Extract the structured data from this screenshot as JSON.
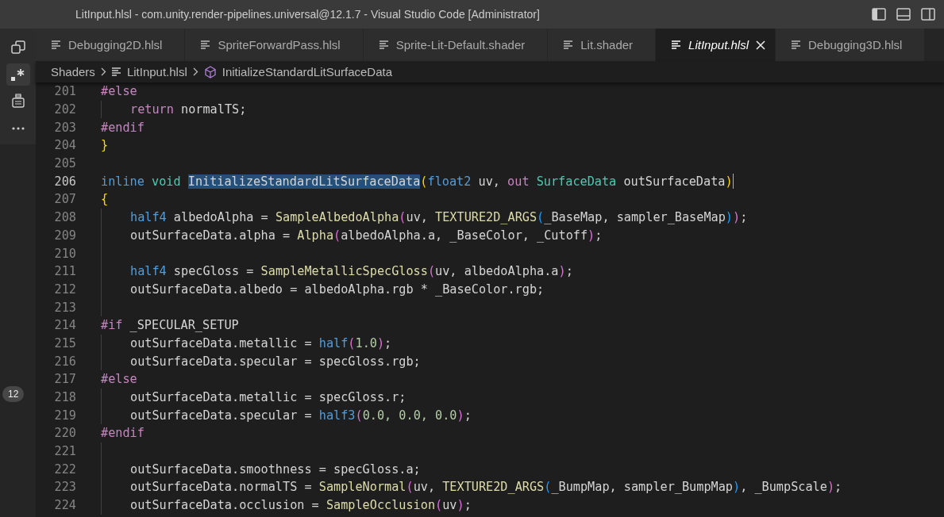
{
  "window": {
    "title": "LitInput.hlsl - com.unity.render-pipelines.universal@12.1.7 - Visual Studio Code [Administrator]"
  },
  "activity_bar": {
    "items": [
      {
        "kind": "copy",
        "selected": false
      },
      {
        "kind": "regex",
        "selected": true
      },
      {
        "kind": "chip",
        "selected": false
      },
      {
        "kind": "more",
        "selected": false
      }
    ],
    "badge": "12"
  },
  "tabs": [
    {
      "label": "Debugging2D.hlsl",
      "selected": false
    },
    {
      "label": "SpriteForwardPass.hlsl",
      "selected": false
    },
    {
      "label": "Sprite-Lit-Default.shader",
      "selected": false
    },
    {
      "label": "Lit.shader",
      "selected": false
    },
    {
      "label": "LitInput.hlsl",
      "selected": true
    },
    {
      "label": "Debugging3D.hlsl",
      "selected": false
    }
  ],
  "breadcrumb": [
    {
      "kind": "folder",
      "label": "Shaders"
    },
    {
      "kind": "file",
      "label": "LitInput.hlsl"
    },
    {
      "kind": "symbol",
      "label": "InitializeStandardLitSurfaceData"
    }
  ],
  "code": [
    {
      "number": "201",
      "current": false,
      "indented": false,
      "tokens": [
        {
          "kind": "pre",
          "text": "#else"
        }
      ]
    },
    {
      "number": "202",
      "current": false,
      "indented": true,
      "tokens": [
        {
          "kind": "pre",
          "text": "return"
        },
        {
          "kind": "text",
          "text": " normalTS;"
        }
      ]
    },
    {
      "number": "203",
      "current": false,
      "indented": false,
      "tokens": [
        {
          "kind": "pre",
          "text": "#endif"
        }
      ]
    },
    {
      "number": "204",
      "current": false,
      "indented": false,
      "tokens": [
        {
          "kind": "b1",
          "text": "}"
        }
      ]
    },
    {
      "number": "205",
      "current": false,
      "indented": false
    },
    {
      "number": "206",
      "current": true,
      "indented": false,
      "tokens": [
        {
          "kind": "type",
          "text": "inline "
        },
        {
          "kind": "cls",
          "text": "void "
        },
        {
          "kind": "selection",
          "text": "InitializeStandardLitSurfaceData"
        },
        {
          "kind": "b1",
          "text": "("
        },
        {
          "kind": "type",
          "text": "float2"
        },
        {
          "kind": "text",
          "text": " uv, "
        },
        {
          "kind": "pre",
          "text": "out "
        },
        {
          "kind": "cls",
          "text": "SurfaceData"
        },
        {
          "kind": "text",
          "text": " outSurfaceData"
        },
        {
          "kind": "b1",
          "text": ")"
        }
      ]
    },
    {
      "number": "207",
      "current": false,
      "indented": false,
      "tokens": [
        {
          "kind": "b1",
          "text": "{"
        }
      ]
    },
    {
      "number": "208",
      "current": false,
      "indented": true,
      "tokens": [
        {
          "kind": "type",
          "text": "half4"
        },
        {
          "kind": "text",
          "text": " albedoAlpha = "
        },
        {
          "kind": "func",
          "text": "SampleAlbedoAlpha"
        },
        {
          "kind": "b2",
          "text": "("
        },
        {
          "kind": "text",
          "text": "uv, "
        },
        {
          "kind": "func",
          "text": "TEXTURE2D_ARGS"
        },
        {
          "kind": "b3",
          "text": "("
        },
        {
          "kind": "text",
          "text": "_BaseMap, sampler_BaseMap"
        },
        {
          "kind": "b3",
          "text": ")"
        },
        {
          "kind": "b2",
          "text": ")"
        },
        {
          "kind": "text",
          "text": ";"
        }
      ]
    },
    {
      "number": "209",
      "current": false,
      "indented": true,
      "tokens": [
        {
          "kind": "text",
          "text": "outSurfaceData.alpha = "
        },
        {
          "kind": "func",
          "text": "Alpha"
        },
        {
          "kind": "b2",
          "text": "("
        },
        {
          "kind": "text",
          "text": "albedoAlpha.a, _BaseColor, _Cutoff"
        },
        {
          "kind": "b2",
          "text": ")"
        },
        {
          "kind": "text",
          "text": ";"
        }
      ]
    },
    {
      "number": "210",
      "current": false,
      "indented": true
    },
    {
      "number": "211",
      "current": false,
      "indented": true,
      "tokens": [
        {
          "kind": "type",
          "text": "half4"
        },
        {
          "kind": "text",
          "text": " specGloss = "
        },
        {
          "kind": "func",
          "text": "SampleMetallicSpecGloss"
        },
        {
          "kind": "b2",
          "text": "("
        },
        {
          "kind": "text",
          "text": "uv, albedoAlpha.a"
        },
        {
          "kind": "b2",
          "text": ")"
        },
        {
          "kind": "text",
          "text": ";"
        }
      ]
    },
    {
      "number": "212",
      "current": false,
      "indented": true,
      "tokens": [
        {
          "kind": "text",
          "text": "outSurfaceData.albedo = albedoAlpha.rgb * _BaseColor.rgb;"
        }
      ]
    },
    {
      "number": "213",
      "current": false,
      "indented": true
    },
    {
      "number": "214",
      "current": false,
      "indented": false,
      "tokens": [
        {
          "kind": "pre",
          "text": "#if"
        },
        {
          "kind": "text",
          "text": " _SPECULAR_SETUP"
        }
      ]
    },
    {
      "number": "215",
      "current": false,
      "indented": true,
      "tokens": [
        {
          "kind": "text",
          "text": "outSurfaceData.metallic = "
        },
        {
          "kind": "type",
          "text": "half"
        },
        {
          "kind": "b2",
          "text": "("
        },
        {
          "kind": "num",
          "text": "1.0"
        },
        {
          "kind": "b2",
          "text": ")"
        },
        {
          "kind": "text",
          "text": ";"
        }
      ]
    },
    {
      "number": "216",
      "current": false,
      "indented": true,
      "tokens": [
        {
          "kind": "text",
          "text": "outSurfaceData.specular = specGloss.rgb;"
        }
      ]
    },
    {
      "number": "217",
      "current": false,
      "indented": false,
      "tokens": [
        {
          "kind": "pre",
          "text": "#else"
        }
      ]
    },
    {
      "number": "218",
      "current": false,
      "indented": true,
      "tokens": [
        {
          "kind": "text",
          "text": "outSurfaceData.metallic = specGloss.r;"
        }
      ]
    },
    {
      "number": "219",
      "current": false,
      "indented": true,
      "tokens": [
        {
          "kind": "text",
          "text": "outSurfaceData.specular = "
        },
        {
          "kind": "type",
          "text": "half3"
        },
        {
          "kind": "b2",
          "text": "("
        },
        {
          "kind": "num",
          "text": "0.0, 0.0, 0.0"
        },
        {
          "kind": "b2",
          "text": ")"
        },
        {
          "kind": "text",
          "text": ";"
        }
      ]
    },
    {
      "number": "220",
      "current": false,
      "indented": false,
      "tokens": [
        {
          "kind": "pre",
          "text": "#endif"
        }
      ]
    },
    {
      "number": "221",
      "current": false,
      "indented": true
    },
    {
      "number": "222",
      "current": false,
      "indented": true,
      "tokens": [
        {
          "kind": "text",
          "text": "outSurfaceData.smoothness = specGloss.a;"
        }
      ]
    },
    {
      "number": "223",
      "current": false,
      "indented": true,
      "tokens": [
        {
          "kind": "text",
          "text": "outSurfaceData.normalTS = "
        },
        {
          "kind": "func",
          "text": "SampleNormal"
        },
        {
          "kind": "b2",
          "text": "("
        },
        {
          "kind": "text",
          "text": "uv, "
        },
        {
          "kind": "func",
          "text": "TEXTURE2D_ARGS"
        },
        {
          "kind": "b3",
          "text": "("
        },
        {
          "kind": "text",
          "text": "_BumpMap, sampler_BumpMap"
        },
        {
          "kind": "b3",
          "text": ")"
        },
        {
          "kind": "text",
          "text": ", _BumpScale"
        },
        {
          "kind": "b2",
          "text": ")"
        },
        {
          "kind": "text",
          "text": ";"
        }
      ]
    },
    {
      "number": "224",
      "current": false,
      "indented": true,
      "tokens": [
        {
          "kind": "text",
          "text": "outSurfaceData.occlusion = "
        },
        {
          "kind": "func",
          "text": "SampleOcclusion"
        },
        {
          "kind": "b2",
          "text": "("
        },
        {
          "kind": "text",
          "text": "uv"
        },
        {
          "kind": "b2",
          "text": ")"
        },
        {
          "kind": "text",
          "text": ";"
        }
      ]
    }
  ]
}
